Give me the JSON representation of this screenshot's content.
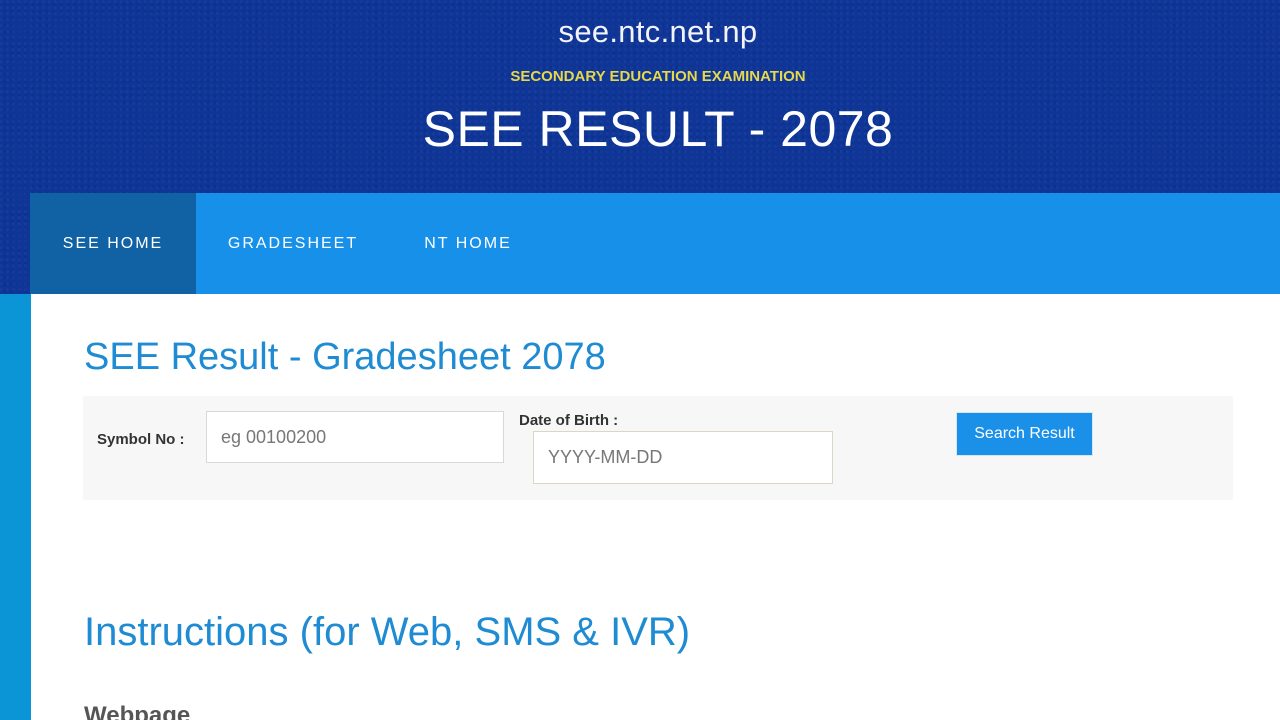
{
  "header": {
    "site_url": "see.ntc.net.np",
    "subtitle": "SECONDARY EDUCATION EXAMINATION",
    "title": "SEE RESULT - 2078"
  },
  "nav": {
    "items": [
      {
        "label": "SEE HOME",
        "active": true
      },
      {
        "label": "GRADESHEET",
        "active": false
      },
      {
        "label": "NT HOME",
        "active": false
      }
    ]
  },
  "main": {
    "heading": "SEE Result - Gradesheet 2078",
    "form": {
      "symbol_label": "Symbol No :",
      "symbol_placeholder": "eg 00100200",
      "symbol_value": "",
      "dob_label": "Date of Birth :",
      "dob_placeholder": "YYYY-MM-DD",
      "dob_value": "",
      "search_button": "Search Result"
    },
    "instructions_heading": "Instructions (for Web, SMS & IVR)",
    "webpage_heading": "Webpage"
  },
  "colors": {
    "header_bg": "#0e3597",
    "nav_bg": "#1790ea",
    "nav_active_bg": "#1162a4",
    "accent_text": "#1e8bd2",
    "subtitle_yellow": "#e6d84a",
    "button_bg": "#1a90e8"
  }
}
